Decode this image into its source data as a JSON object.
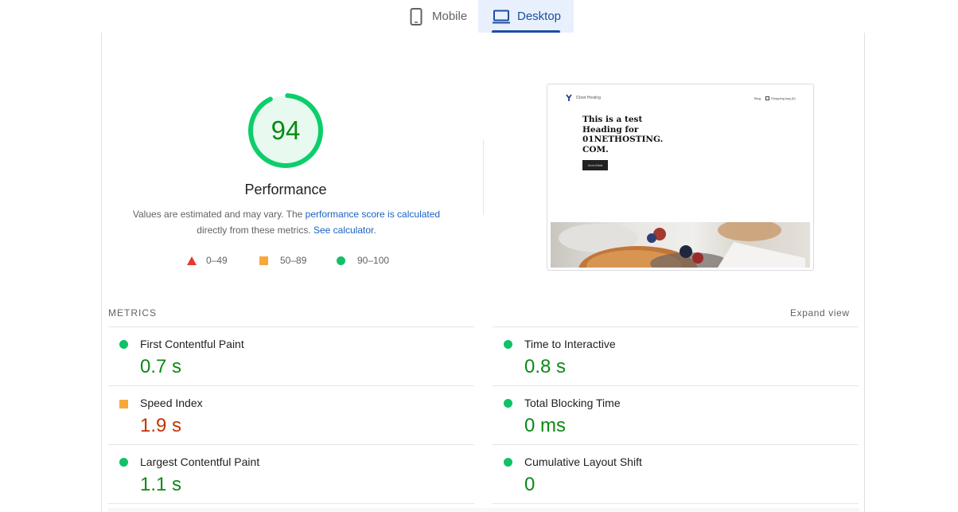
{
  "tabs": [
    {
      "label": "Mobile",
      "icon": "mobile-phone-icon",
      "selected": false
    },
    {
      "label": "Desktop",
      "icon": "desktop-laptop-icon",
      "selected": true
    }
  ],
  "score": {
    "value": "94",
    "fraction": 0.94,
    "label": "Performance",
    "color": "#0cce6b"
  },
  "description": {
    "text_before": "Values are estimated and may vary. The ",
    "link1": "performance score is calculated",
    "text_middle": " directly from these metrics. ",
    "link2": "See calculator",
    "text_after": "."
  },
  "legend": [
    {
      "shape": "triangle",
      "range": "0–49",
      "color": "#e5392e"
    },
    {
      "shape": "square",
      "range": "50–89",
      "color": "#f7a83a"
    },
    {
      "shape": "circle",
      "range": "90–100",
      "color": "#10c165"
    }
  ],
  "screenshot": {
    "site_name": "01net Hosting",
    "nav_blog": "Blog",
    "nav_bag": "Shopping bag (0)",
    "heading": "This is a test Heading for 01NETHOSTING. COM.",
    "button": "Go to 01net"
  },
  "metrics": {
    "title": "METRICS",
    "expand_label": "Expand view",
    "items": [
      {
        "name": "First Contentful Paint",
        "value": "0.7 s",
        "rating": "good"
      },
      {
        "name": "Time to Interactive",
        "value": "0.8 s",
        "rating": "good"
      },
      {
        "name": "Speed Index",
        "value": "1.9 s",
        "rating": "average"
      },
      {
        "name": "Total Blocking Time",
        "value": "0 ms",
        "rating": "good"
      },
      {
        "name": "Largest Contentful Paint",
        "value": "1.1 s",
        "rating": "good"
      },
      {
        "name": "Cumulative Layout Shift",
        "value": "0",
        "rating": "good"
      }
    ]
  },
  "colors": {
    "good": "#0a8a14",
    "average": "#c33300",
    "accent": "#1a4fa0"
  }
}
